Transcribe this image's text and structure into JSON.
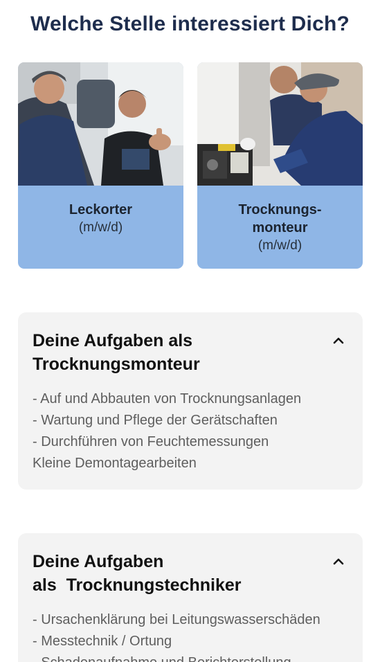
{
  "page": {
    "title": "Welche Stelle interessiert Dich?"
  },
  "cards": [
    {
      "title": "Leckorter",
      "subtitle": "(m/w/d)"
    },
    {
      "title": "Trocknungs-\nmonteur",
      "title_line1": "Trocknungs-",
      "title_line2": "monteur",
      "subtitle": "(m/w/d)"
    }
  ],
  "accordions": [
    {
      "title": "Deine Aufgaben als\nTrocknungsmonteur",
      "expanded": true,
      "items": [
        "- Auf und Abbauten von Trocknungsanlagen",
        "- Wartung und Pflege der Gerätschaften",
        "- Durchführen von Feuchtemessungen",
        "Kleine Demontagearbeiten"
      ]
    },
    {
      "title": "Deine Aufgaben\nals  Trocknungstechniker",
      "expanded": true,
      "items": [
        "- Ursachenklärung bei Leitungswasserschäden",
        "- Messtechnik / Ortung",
        "- Schadenaufnahme und Berichterstellung"
      ]
    }
  ],
  "colors": {
    "title": "#1e2d4d",
    "card_background": "#8fb6e6",
    "accordion_background": "#f3f3f3",
    "body_text": "#5e5e5e"
  },
  "icons": {
    "toggle": "chevron-up-icon"
  }
}
